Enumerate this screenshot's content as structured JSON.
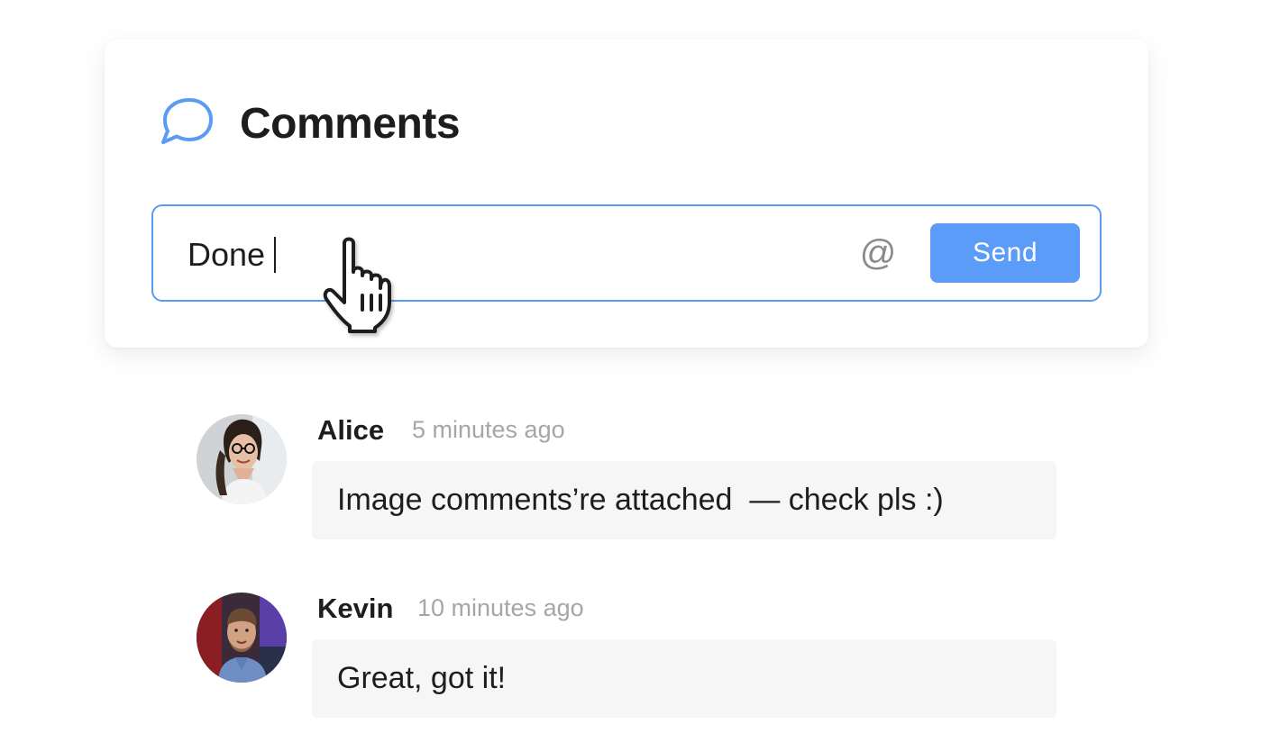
{
  "header": {
    "title": "Comments",
    "icon": "speech-bubble-icon",
    "accent_color": "#5b9bf3"
  },
  "composer": {
    "value": "Done",
    "mention_label": "@",
    "send_label": "Send",
    "send_color": "#5a9cf8"
  },
  "comments": [
    {
      "author": "Alice",
      "time": "5 minutes ago",
      "text": "Image comments’re attached  — check pls :)"
    },
    {
      "author": "Kevin",
      "time": "10 minutes ago",
      "text": "Great, got it!"
    }
  ]
}
